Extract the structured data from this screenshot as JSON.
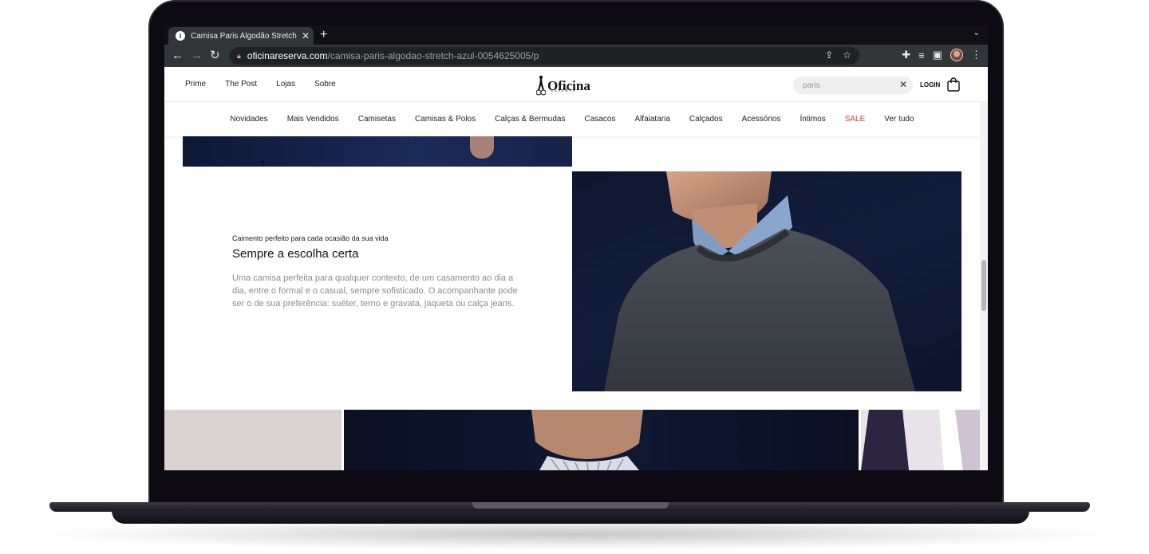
{
  "browser": {
    "tab_title": "Camisa Paris Algodão Stretch A",
    "tab_favicon": "i",
    "tab_close": "✕",
    "new_tab": "+",
    "tab_search": "⌄",
    "url_domain": "oficinareserva.com",
    "url_path": "/camisa-paris-algodao-stretch-azul-0054625005/p",
    "icons": [
      "back-arrow-icon",
      "forward-arrow-icon",
      "reload-icon",
      "lock-icon",
      "share-icon",
      "star-icon",
      "extensions-icon",
      "reading-list-icon",
      "side-panel-icon",
      "profile-avatar-icon",
      "kebab-menu-icon"
    ]
  },
  "site": {
    "top_links": [
      "Prime",
      "The Post",
      "Lojas",
      "Sobre"
    ],
    "logo_text": "Oficina",
    "logo_sub": "RESERVA",
    "search_value": "paris",
    "login_label": "LOGIN",
    "menu": [
      "Novidades",
      "Mais Vendidos",
      "Camisetas",
      "Camisas & Polos",
      "Calças & Bermudas",
      "Casacos",
      "Alfaiataria",
      "Calçados",
      "Acessórios",
      "Íntimos",
      "SALE",
      "Ver tudo"
    ],
    "sale_color": "#e2363b"
  },
  "section": {
    "eyebrow": "Caimento perfeito para cada ocasião da sua vida",
    "title": "Sempre a escolha certa",
    "body": "Uma camisa perfeita para qualquer contexto, de um casamento ao dia a dia, entre o formal e o casual, sempre sofisticado. O acompanhante pode ser o de sua preferência: suéter, terno e gravata, jaqueta ou calça jeans."
  }
}
